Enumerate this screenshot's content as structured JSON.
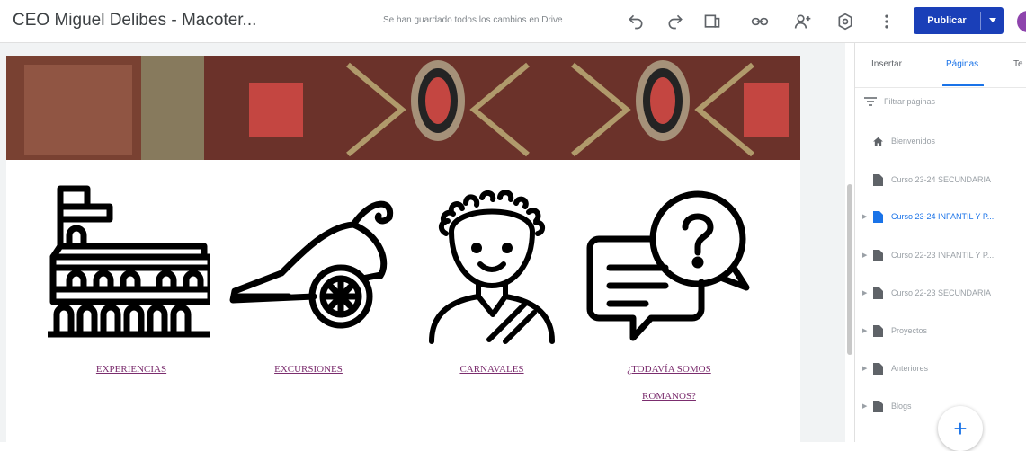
{
  "header": {
    "site_title": "CEO Miguel Delibes - Macoter...",
    "save_status": "Se han guardado todos los cambios en Drive",
    "publish_label": "Publicar",
    "icons": [
      "undo-icon",
      "redo-icon",
      "preview-icon",
      "link-icon",
      "share-icon",
      "settings-icon",
      "more-icon"
    ]
  },
  "content": {
    "sections": [
      {
        "label": "EXPERIENCIAS",
        "icon": "colosseum-icon"
      },
      {
        "label": "EXCURSIONES",
        "icon": "chariot-icon"
      },
      {
        "label": "CARNAVALES",
        "icon": "roman-emperor-icon"
      },
      {
        "label": "¿TODAVÍA SOMOS",
        "label_line2": "ROMANOS?",
        "icon": "question-chat-icon"
      }
    ]
  },
  "panel": {
    "tabs": [
      {
        "label": "Insertar",
        "active": false
      },
      {
        "label": "Páginas",
        "active": true
      },
      {
        "label": "Te",
        "active": false
      }
    ],
    "filter_placeholder": "Filtrar páginas",
    "pages": [
      {
        "label": "Bienvenidos",
        "icon": "home-icon",
        "expandable": false,
        "active": false
      },
      {
        "label": "Curso 23-24 SECUNDARIA",
        "icon": "page-icon",
        "expandable": false,
        "active": false
      },
      {
        "label": "Curso 23-24 INFANTIL Y P...",
        "icon": "page-icon",
        "expandable": true,
        "active": true
      },
      {
        "label": "Curso 22-23 INFANTIL Y P...",
        "icon": "page-icon",
        "expandable": true,
        "active": false
      },
      {
        "label": "Curso 22-23 SECUNDARIA",
        "icon": "page-icon",
        "expandable": true,
        "active": false
      },
      {
        "label": "Proyectos",
        "icon": "page-icon",
        "expandable": true,
        "active": false
      },
      {
        "label": "Anteriores",
        "icon": "page-icon",
        "expandable": true,
        "active": false
      },
      {
        "label": "Blogs",
        "icon": "page-icon",
        "expandable": true,
        "active": false
      }
    ],
    "add_label": "+"
  },
  "colors": {
    "accent": "#1a73e8",
    "publish": "#1a3fb8",
    "link": "#7b2d6e",
    "avatar": "#8e44ad"
  }
}
